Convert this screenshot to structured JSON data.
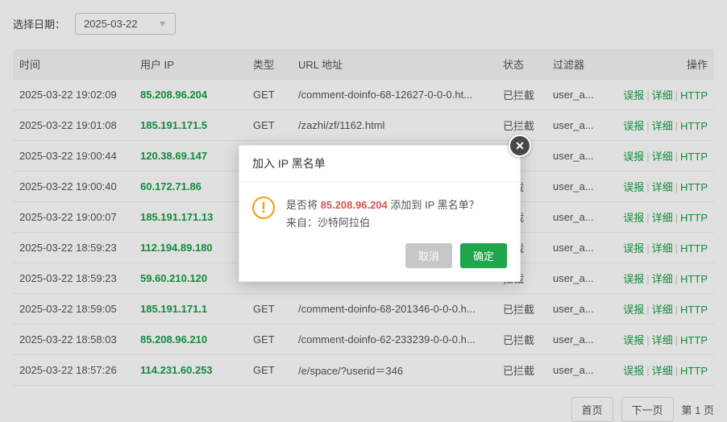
{
  "topbar": {
    "date_label": "选择日期：",
    "date_value": "2025-03-22"
  },
  "thead": {
    "time": "时间",
    "ip": "用户 IP",
    "type": "类型",
    "url": "URL 地址",
    "status": "状态",
    "filter": "过滤器",
    "ops": "操作"
  },
  "ops": {
    "misreport": "误报",
    "detail": "详细",
    "http": "HTTP"
  },
  "rows": [
    {
      "time": "2025-03-22 19:02:09",
      "ip": "85.208.96.204",
      "type": "GET",
      "url": "/comment-doinfo-68-12627-0-0-0.ht...",
      "status": "已拦截",
      "filter": "user_a..."
    },
    {
      "time": "2025-03-22 19:01:08",
      "ip": "185.191.171.5",
      "type": "GET",
      "url": "/zazhi/zf/1162.html",
      "status": "已拦截",
      "filter": "user_a..."
    },
    {
      "time": "2025-03-22 19:00:44",
      "ip": "120.38.69.147",
      "type": "",
      "url": "",
      "status": "截",
      "filter": "user_a..."
    },
    {
      "time": "2025-03-22 19:00:40",
      "ip": "60.172.71.86",
      "type": "",
      "url": "",
      "status": "拦截",
      "filter": "user_a..."
    },
    {
      "time": "2025-03-22 19:00:07",
      "ip": "185.191.171.13",
      "type": "",
      "url": "",
      "status": "拦截",
      "filter": "user_a..."
    },
    {
      "time": "2025-03-22 18:59:23",
      "ip": "112.194.89.180",
      "type": "",
      "url": "",
      "status": "拦截",
      "filter": "user_a..."
    },
    {
      "time": "2025-03-22 18:59:23",
      "ip": "59.60.210.120",
      "type": "",
      "url": "",
      "status": "拦截",
      "filter": "user_a..."
    },
    {
      "time": "2025-03-22 18:59:05",
      "ip": "185.191.171.1",
      "type": "GET",
      "url": "/comment-doinfo-68-201346-0-0-0.h...",
      "status": "已拦截",
      "filter": "user_a..."
    },
    {
      "time": "2025-03-22 18:58:03",
      "ip": "85.208.96.210",
      "type": "GET",
      "url": "/comment-doinfo-62-233239-0-0-0.h...",
      "status": "已拦截",
      "filter": "user_a..."
    },
    {
      "time": "2025-03-22 18:57:26",
      "ip": "114.231.60.253",
      "type": "GET",
      "url": "/e/space/?userid＝346",
      "status": "已拦截",
      "filter": "user_a..."
    }
  ],
  "pager": {
    "first": "首页",
    "next": "下一页",
    "page_info": "第 1 页"
  },
  "modal": {
    "title": "加入 IP 黑名单",
    "confirm_prefix": "是否将 ",
    "ip": "85.208.96.204",
    "confirm_suffix": " 添加到 IP 黑名单？",
    "origin_label": "来自：",
    "origin_value": "沙特阿拉伯",
    "cancel": "取消",
    "ok": "确定"
  }
}
